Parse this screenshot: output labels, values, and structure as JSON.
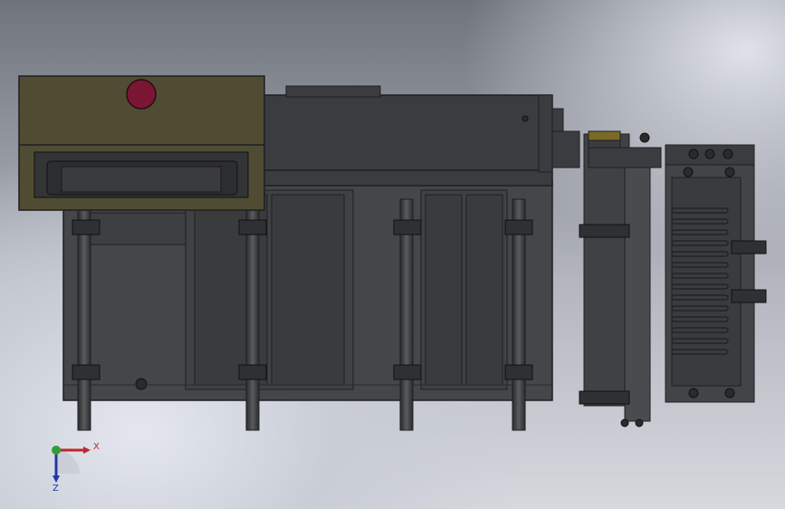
{
  "viewport": {
    "axis": {
      "x_label": "X",
      "z_label": "Z"
    }
  },
  "colors": {
    "body_dark": "#3a3b3d",
    "body_mid": "#4a4b4e",
    "panel_olive": "#4f4c33",
    "highlight_red": "#7a1633",
    "edge": "#1e1f21",
    "axis_x": "#c0262d",
    "axis_z": "#2536a5",
    "axis_y": "#2e9d3a"
  },
  "icons": [
    "coordinate-triad-icon"
  ]
}
